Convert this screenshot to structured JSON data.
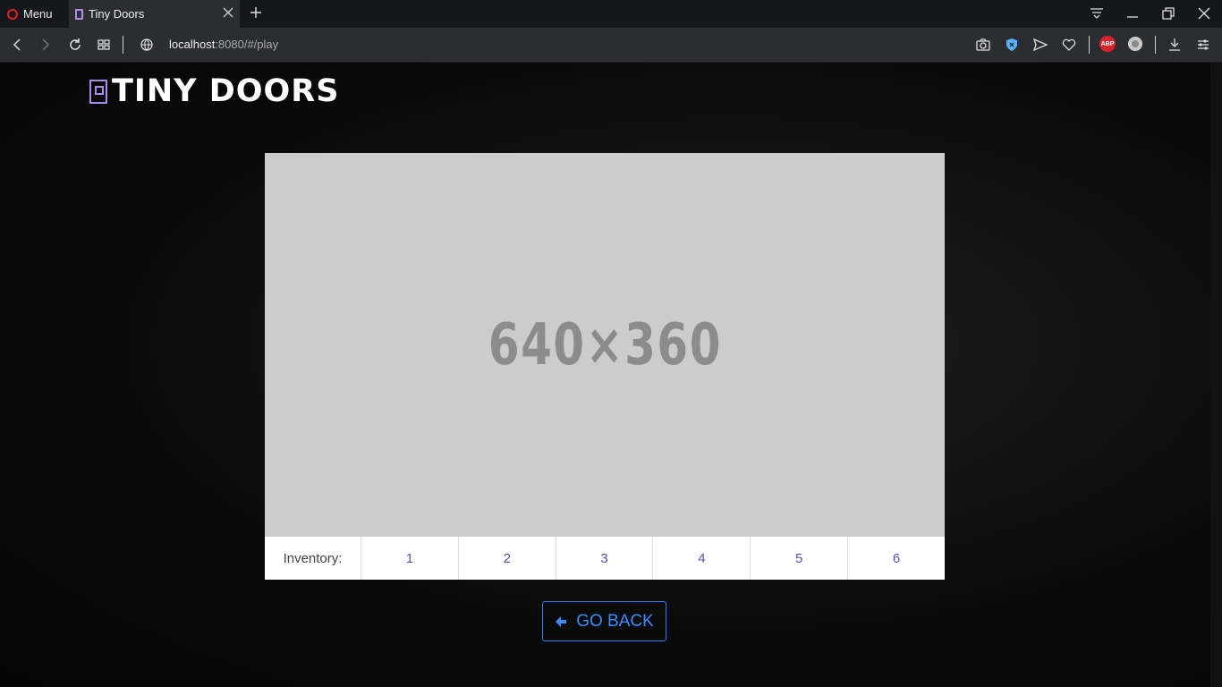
{
  "browser": {
    "menu_label": "Menu",
    "tab_title": "Tiny Doors",
    "url_host": "localhost",
    "url_rest": ":8080/#/play",
    "icons": [
      "back-icon",
      "forward-icon",
      "reload-icon",
      "grid-icon",
      "globe-icon",
      "camera-icon",
      "shield-icon",
      "send-icon",
      "heart-icon",
      "adblock-icon",
      "vpn-icon",
      "download-icon",
      "easy-setup-icon"
    ],
    "adblock_text": "ABP"
  },
  "header": {
    "logo_text": "TINY DOORS"
  },
  "game": {
    "placeholder_text": "640×360"
  },
  "inventory": {
    "label": "Inventory:",
    "slots": [
      "1",
      "2",
      "3",
      "4",
      "5",
      "6"
    ]
  },
  "actions": {
    "go_back_label": "GO BACK"
  },
  "colors": {
    "accent": "#3b8cff",
    "slot_text": "#5b4db5",
    "logo_accent": "#a88af0"
  }
}
